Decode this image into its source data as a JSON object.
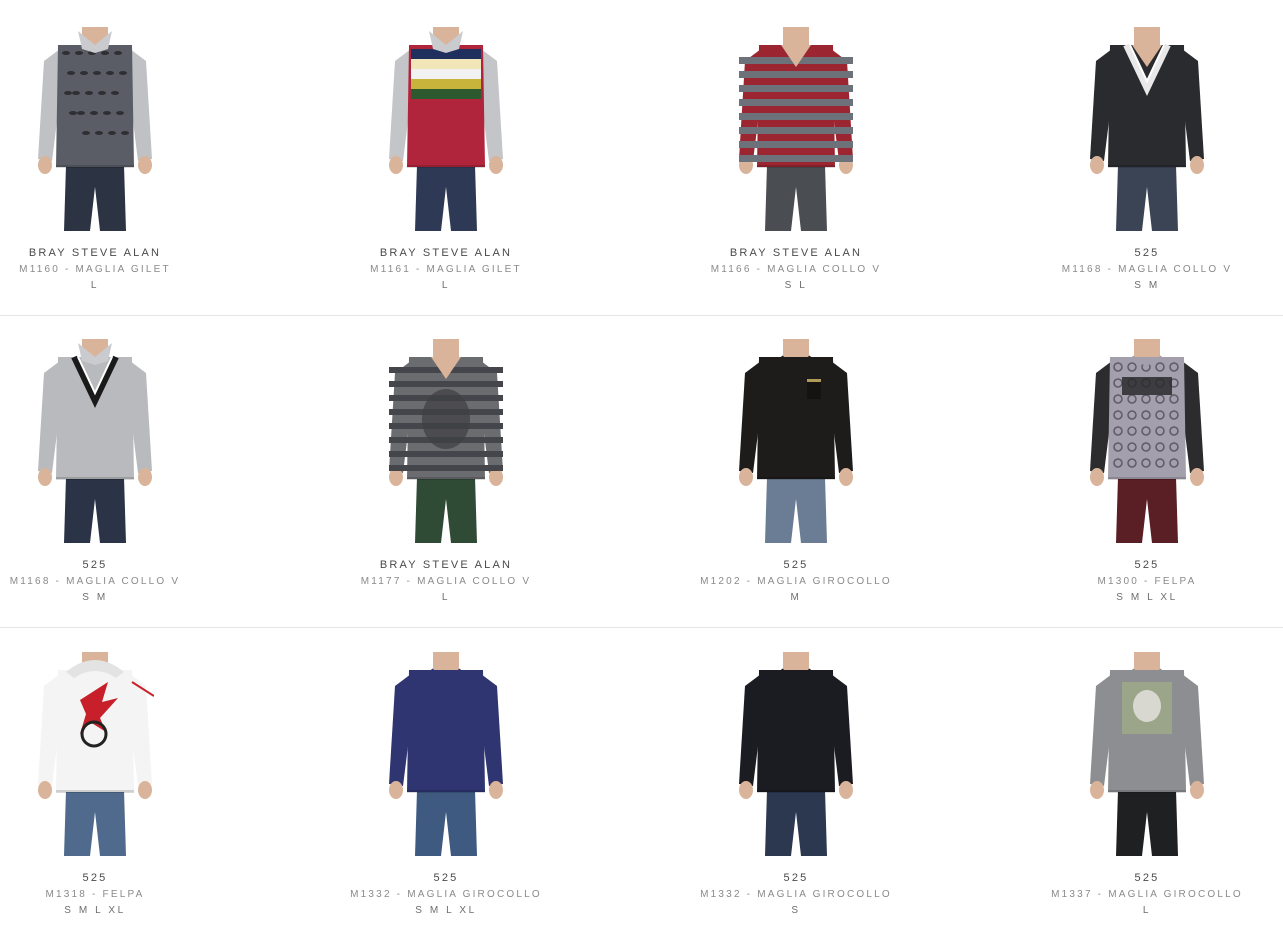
{
  "products": [
    {
      "brand": "BRAY STEVE ALAN",
      "model": "M1160 - MAGLIA GILET",
      "sizes": "L",
      "sweater": "#5a5d66",
      "sleeve": "#bfc1c4",
      "pants": "#2c3444",
      "pattern": "leaf-vest",
      "accent": "#2e2f33",
      "head": "shirt-collar"
    },
    {
      "brand": "BRAY STEVE ALAN",
      "model": "M1161 - MAGLIA GILET",
      "sizes": "L",
      "sweater": "#b0243c",
      "sleeve": "#c4c5c9",
      "pants": "#2e3a55",
      "pattern": "stripe-vest",
      "accent": "#22386a",
      "head": "shirt-collar"
    },
    {
      "brand": "BRAY STEVE ALAN",
      "model": "M1166 - MAGLIA COLLO V",
      "sizes": "S L",
      "sweater": "#9b2530",
      "sleeve": "#9b2530",
      "pants": "#4a4d52",
      "pattern": "red-grey-stripes",
      "accent": "#6d7179",
      "head": "v-neck"
    },
    {
      "brand": "525",
      "model": "M1168 - MAGLIA COLLO V",
      "sizes": "S M",
      "sweater": "#2a2b2e",
      "sleeve": "#2a2b2e",
      "pants": "#3b4455",
      "pattern": "cricket-v",
      "accent": "#e9e9e9",
      "head": "v-neck"
    },
    {
      "brand": "525",
      "model": "M1168 - MAGLIA COLLO V",
      "sizes": "S M",
      "sweater": "#b9babd",
      "sleeve": "#b9babd",
      "pants": "#2b3447",
      "pattern": "cricket-v",
      "accent": "#1a1a1a",
      "head": "shirt-collar"
    },
    {
      "brand": "BRAY STEVE ALAN",
      "model": "M1177 - MAGLIA COLLO V",
      "sizes": "L",
      "sweater": "#6b6c70",
      "sleeve": "#6b6c70",
      "pants": "#2f4a35",
      "pattern": "print-stripes",
      "accent": "#44464b",
      "head": "v-neck"
    },
    {
      "brand": "525",
      "model": "M1202 - MAGLIA GIROCOLLO",
      "sizes": "M",
      "sweater": "#1e1c1b",
      "sleeve": "#1e1c1b",
      "pants": "#6b7d95",
      "pattern": "pocket",
      "accent": "#b09a5a",
      "head": "crew"
    },
    {
      "brand": "525",
      "model": "M1300 - FELPA",
      "sizes": "S M L XL",
      "sweater": "#a49fac",
      "sleeve": "#2c2c2e",
      "pants": "#5a1e25",
      "pattern": "damask",
      "accent": "#2a2a2e",
      "head": "crew"
    },
    {
      "brand": "525",
      "model": "M1318 - FELPA",
      "sizes": "S M L XL",
      "sweater": "#f4f4f4",
      "sleeve": "#f4f4f4",
      "pants": "#4f6a8c",
      "pattern": "griffin",
      "accent": "#c8202a",
      "head": "hood"
    },
    {
      "brand": "525",
      "model": "M1332 - MAGLIA GIROCOLLO",
      "sizes": "S M L XL",
      "sweater": "#2e3570",
      "sleeve": "#2e3570",
      "pants": "#3e5a80",
      "pattern": "plain",
      "accent": "#3b4280",
      "head": "crew"
    },
    {
      "brand": "525",
      "model": "M1332 - MAGLIA GIROCOLLO",
      "sizes": "S",
      "sweater": "#1b1c22",
      "sleeve": "#1b1c22",
      "pants": "#2c3850",
      "pattern": "plain",
      "accent": "#3a3c44",
      "head": "crew"
    },
    {
      "brand": "525",
      "model": "M1337 - MAGLIA GIROCOLLO",
      "sizes": "L",
      "sweater": "#8d8e91",
      "sleeve": "#8d8e91",
      "pants": "#1f2022",
      "pattern": "skull-print",
      "accent": "#9aa58a",
      "head": "crew"
    }
  ]
}
